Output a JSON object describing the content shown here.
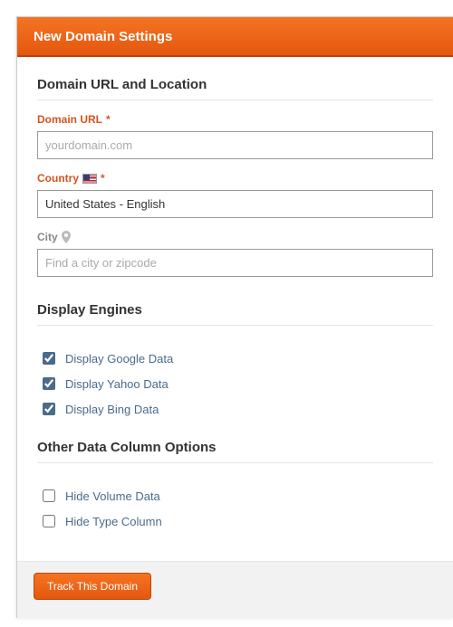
{
  "header": {
    "title": "New Domain Settings"
  },
  "sections": {
    "url_location": {
      "title": "Domain URL and Location",
      "domain_url": {
        "label": "Domain URL",
        "required": "*",
        "placeholder": "yourdomain.com",
        "value": ""
      },
      "country": {
        "label": "Country",
        "required": "*",
        "value": "United States - English"
      },
      "city": {
        "label": "City",
        "placeholder": "Find a city or zipcode",
        "value": ""
      }
    },
    "engines": {
      "title": "Display Engines",
      "items": [
        {
          "label": "Display Google Data",
          "checked": true
        },
        {
          "label": "Display Yahoo Data",
          "checked": true
        },
        {
          "label": "Display Bing Data",
          "checked": true
        }
      ]
    },
    "columns": {
      "title": "Other Data Column Options",
      "items": [
        {
          "label": "Hide Volume Data",
          "checked": false
        },
        {
          "label": "Hide Type Column",
          "checked": false
        }
      ]
    }
  },
  "footer": {
    "submit_label": "Track This Domain"
  }
}
